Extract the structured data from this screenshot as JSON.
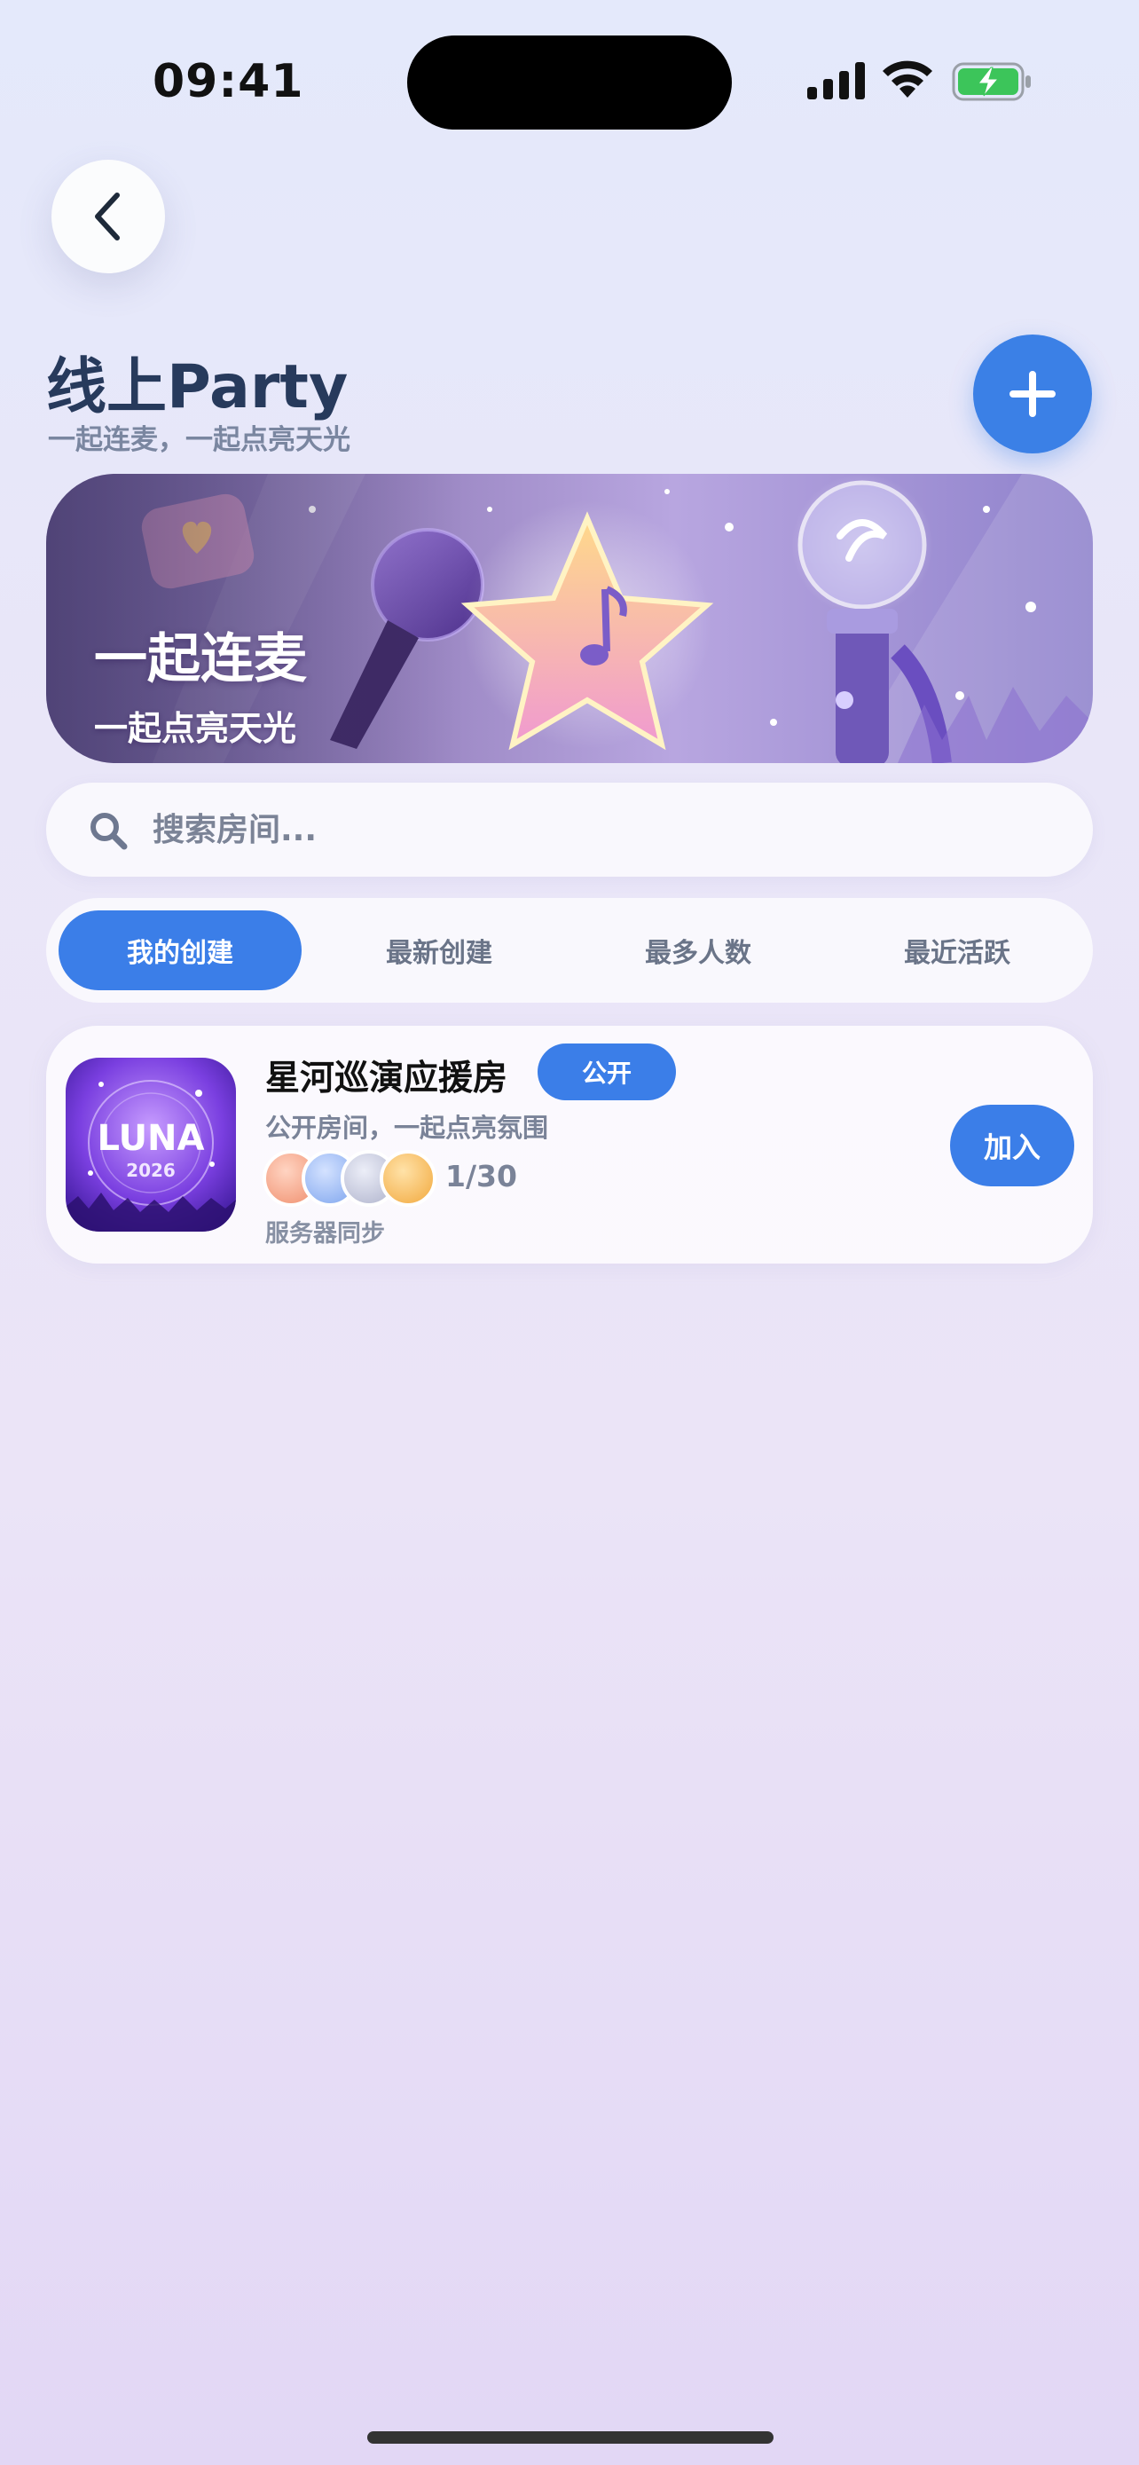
{
  "status_bar": {
    "time": "09:41"
  },
  "header": {
    "title": "线上Party",
    "subtitle": "一起连麦，一起点亮天光"
  },
  "banner": {
    "title": "一起连麦",
    "subtitle": "一起点亮天光"
  },
  "search": {
    "placeholder": "搜索房间..."
  },
  "tabs": [
    {
      "label": "我的创建",
      "active": true
    },
    {
      "label": "最新创建",
      "active": false
    },
    {
      "label": "最多人数",
      "active": false
    },
    {
      "label": "最近活跃",
      "active": false
    }
  ],
  "rooms": [
    {
      "thumb_title": "LUNA",
      "thumb_year": "2026",
      "name": "星河巡演应援房",
      "badge": "公开",
      "description": "公开房间，一起点亮氛围",
      "count": "1/30",
      "sync_status": "服务器同步",
      "join_label": "加入",
      "avatar_colors": [
        "#f4a58a",
        "#8fb2f0",
        "#c2c5d8",
        "#f6bb58"
      ]
    }
  ],
  "colors": {
    "accent": "#3b7ee8",
    "title": "#273a5c",
    "muted": "#7a86a0"
  }
}
